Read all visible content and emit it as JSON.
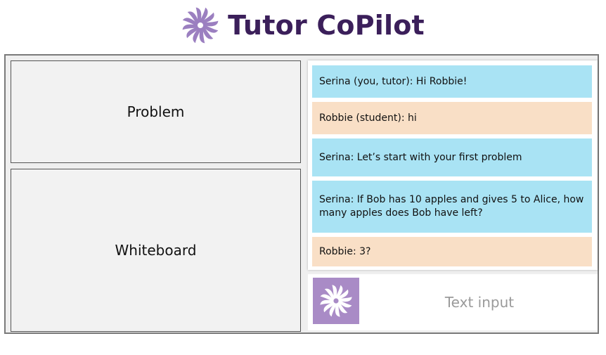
{
  "app": {
    "title": "Tutor CoPilot",
    "logo_icon": "spiral-flower-icon",
    "brand_color": "#3b1f5a",
    "accent_color": "#a98bc6"
  },
  "panels": {
    "problem_label": "Problem",
    "whiteboard_label": "Whiteboard"
  },
  "chat": {
    "messages": [
      {
        "role": "tutor",
        "text": "Serina (you, tutor): Hi Robbie!"
      },
      {
        "role": "student",
        "text": "Robbie (student): hi"
      },
      {
        "role": "tutor",
        "text": "Serina: Let’s start with your first problem"
      },
      {
        "role": "tutor",
        "text": "Serina: If Bob has 10 apples and gives 5 to Alice, how many apples does Bob have left?"
      },
      {
        "role": "student",
        "text": "Robbie: 3?"
      }
    ],
    "colors": {
      "tutor": "#a9e3f4",
      "student": "#f9dfc6"
    }
  },
  "input": {
    "placeholder": "Text input",
    "value": "",
    "copilot_button_icon": "spiral-flower-icon"
  }
}
